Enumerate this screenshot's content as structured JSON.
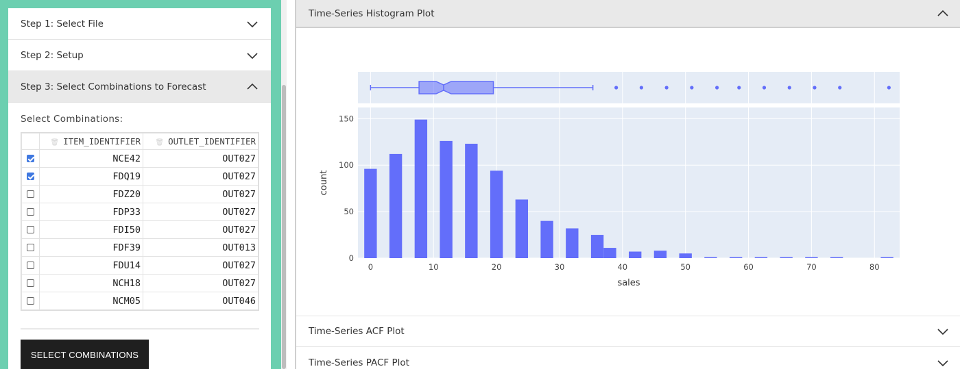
{
  "left": {
    "accordion": [
      {
        "label": "Step 1: Select File",
        "open": false
      },
      {
        "label": "Step 2: Setup",
        "open": false
      },
      {
        "label": "Step 3: Select Combinations to Forecast",
        "open": true
      }
    ],
    "select_label": "Select Combinations:",
    "grid": {
      "columns": [
        "ITEM_IDENTIFIER",
        "OUTLET_IDENTIFIER"
      ],
      "rows": [
        {
          "checked": true,
          "item": "NCE42",
          "outlet": "OUT027"
        },
        {
          "checked": true,
          "item": "FDQ19",
          "outlet": "OUT027"
        },
        {
          "checked": false,
          "item": "FDZ20",
          "outlet": "OUT027"
        },
        {
          "checked": false,
          "item": "FDP33",
          "outlet": "OUT027"
        },
        {
          "checked": false,
          "item": "FDI50",
          "outlet": "OUT027"
        },
        {
          "checked": false,
          "item": "FDF39",
          "outlet": "OUT013"
        },
        {
          "checked": false,
          "item": "FDU14",
          "outlet": "OUT027"
        },
        {
          "checked": false,
          "item": "NCH18",
          "outlet": "OUT027"
        },
        {
          "checked": false,
          "item": "NCM05",
          "outlet": "OUT046"
        }
      ]
    },
    "button_label": "SELECT COMBINATIONS"
  },
  "right": {
    "sections": [
      {
        "label": "Time-Series Histogram Plot",
        "open": true
      },
      {
        "label": "Time-Series ACF Plot",
        "open": false
      },
      {
        "label": "Time-Series PACF Plot",
        "open": false
      }
    ]
  },
  "colors": {
    "accent_frame": "#6ccfb0",
    "bar": "#636efa",
    "plot_bg": "#e5ecf6",
    "checkbox": "#3f78e0"
  },
  "chart_data": {
    "type": "bar",
    "xlabel": "sales",
    "ylabel": "count",
    "xlim": [
      -2,
      84
    ],
    "ylim": [
      0,
      150
    ],
    "xticks": [
      0,
      10,
      20,
      30,
      40,
      50,
      60,
      70,
      80
    ],
    "yticks": [
      0,
      50,
      100,
      150
    ],
    "bin_width": 2,
    "bins": [
      {
        "x": 0,
        "count": 96
      },
      {
        "x": 4,
        "count": 112
      },
      {
        "x": 8,
        "count": 149
      },
      {
        "x": 12,
        "count": 126
      },
      {
        "x": 16,
        "count": 123
      },
      {
        "x": 20,
        "count": 94
      },
      {
        "x": 24,
        "count": 63
      },
      {
        "x": 28,
        "count": 40
      },
      {
        "x": 32,
        "count": 32
      },
      {
        "x": 36,
        "count": 25
      },
      {
        "x": 38,
        "count": 11
      },
      {
        "x": 42,
        "count": 7
      },
      {
        "x": 46,
        "count": 8
      },
      {
        "x": 50,
        "count": 5
      },
      {
        "x": 54,
        "count": 1
      },
      {
        "x": 58,
        "count": 1
      },
      {
        "x": 62,
        "count": 1
      },
      {
        "x": 66,
        "count": 1
      },
      {
        "x": 70,
        "count": 1
      },
      {
        "x": 74,
        "count": 1
      },
      {
        "x": 82,
        "count": 1
      }
    ],
    "box": {
      "min": 0,
      "q1": 7.7,
      "median": 11.6,
      "q3": 19.5,
      "max": 35.3,
      "outliers": [
        39,
        43,
        47,
        51,
        55,
        58.5,
        62.5,
        66.5,
        70.5,
        74.5,
        82.3
      ]
    },
    "grid": true
  }
}
